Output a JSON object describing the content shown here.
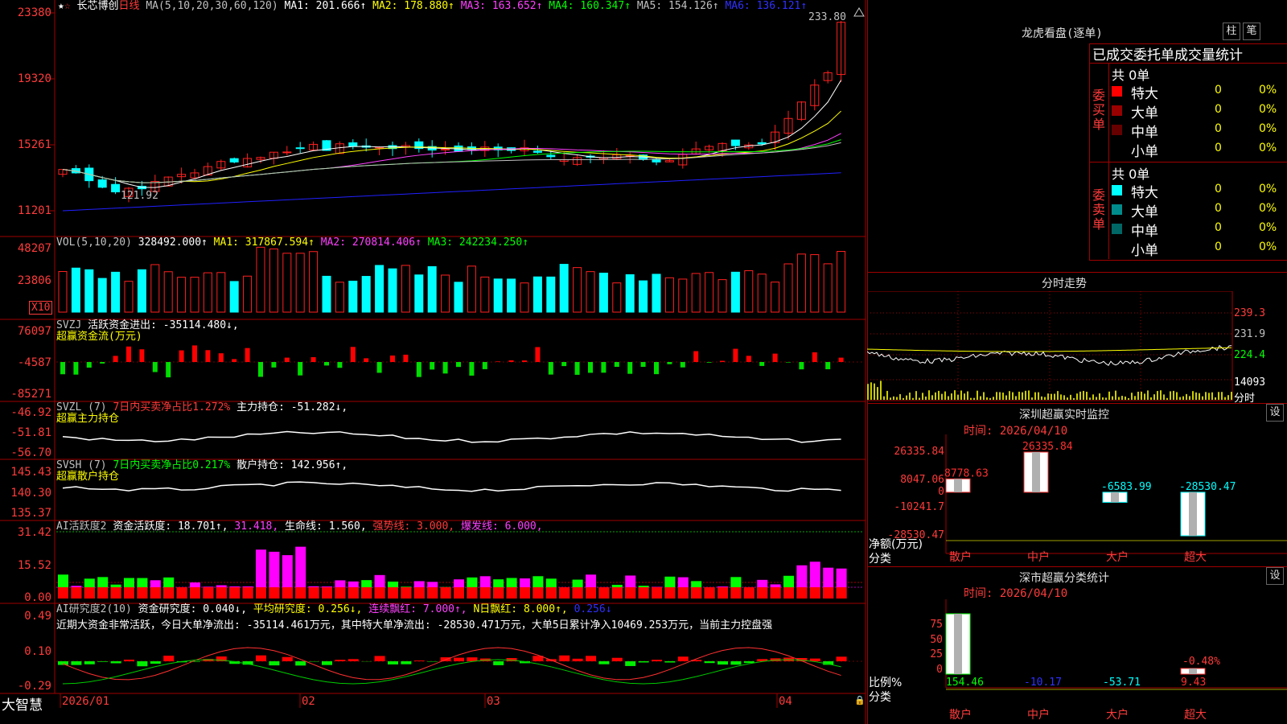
{
  "logo": "大智慧",
  "colors": {
    "up": "#ff2020",
    "down": "#00ffff",
    "ma1": "#ffffff",
    "ma2": "#ffff00",
    "ma3": "#ff40ff",
    "ma4": "#00ff00",
    "ma5": "#c0c0c0",
    "ma6": "#2020ff",
    "grid": "#a00000"
  },
  "main": {
    "stock_name": "长芯博创",
    "period": "日线",
    "ma_def": "MA(5,10,20,30,60,120)",
    "ma1": "MA1: 201.666↑",
    "ma2": "MA2: 178.880↑",
    "ma3": "MA3: 163.652↑",
    "ma4": "MA4: 160.347↑",
    "ma5": "MA5: 154.126↑",
    "ma6": "MA6: 136.121↑",
    "y_ticks": [
      "23380",
      "19320",
      "15261",
      "11201"
    ],
    "high_label": "233.80",
    "low_label": "121.92"
  },
  "vol": {
    "def": "VOL(5,10,20)",
    "value": "328492.000↑",
    "ma1": "MA1: 317867.594↑",
    "ma2": "MA2: 270814.406↑",
    "ma3": "MA3: 242234.250↑",
    "y_ticks": [
      "48207",
      "23806"
    ],
    "unit": "X10"
  },
  "svzj": {
    "def": "SVZJ",
    "label": "活跃资金进出: -35114.480↓,",
    "title2": "超赢资金流(万元)",
    "y_ticks": [
      "76097",
      "-4587",
      "-85271"
    ]
  },
  "svzl": {
    "def": "SVZL (7)",
    "ratio": "7日内买卖净占比1.272%",
    "label": "主力持仓: -51.282↓,",
    "title2": "超赢主力持仓",
    "y_ticks": [
      "-46.92",
      "-51.81",
      "-56.70"
    ]
  },
  "svsh": {
    "def": "SVSH (7)",
    "ratio": "7日内买卖净占比0.217%",
    "label": "散户持仓: 142.956↑,",
    "title2": "超赢散户持仓",
    "y_ticks": [
      "145.43",
      "140.30",
      "135.37"
    ]
  },
  "ai1": {
    "def": "AI活跃度2",
    "a": "资金活跃度: 18.701↑,",
    "b": "31.418,",
    "c": "生命线: 1.560,",
    "d": "强势线: 3.000,",
    "e": "爆发线: 6.000,",
    "y_ticks": [
      "31.42",
      "15.52",
      "0.00"
    ]
  },
  "ai2": {
    "def": "AI研究度2(10)",
    "a": "资金研究度: 0.040↓,",
    "b": "平均研究度: 0.256↓,",
    "c": "连续飘红: 7.000↑,",
    "d": "N日飘红: 8.000↑,",
    "e": "0.256↓",
    "comment": "近期大资金非常活跃，今日大单净流出: -35114.461万元，其中特大单净流出: -28530.471万元，大单5日累计净入10469.253万元，当前主力控盘强",
    "y_ticks": [
      "0.49",
      "0.10",
      "-0.29"
    ]
  },
  "x_axis": [
    "2026/01",
    "02",
    "03",
    "04"
  ],
  "lhb": {
    "title": "龙虎看盘(逐单)",
    "btn1": "柱",
    "btn2": "笔",
    "tabs": "已成交委托单成交量统计",
    "buy_side": "委买单",
    "sell_side": "委卖单",
    "buy_total": "共 0单",
    "sell_total": "共 0单",
    "buy_rows": [
      {
        "name": "特大",
        "count": "0",
        "pct": "0%",
        "color": "#ff0000"
      },
      {
        "name": "大单",
        "count": "0",
        "pct": "0%",
        "color": "#990000"
      },
      {
        "name": "中单",
        "count": "0",
        "pct": "0%",
        "color": "#660000"
      },
      {
        "name": "小单",
        "count": "0",
        "pct": "0%",
        "color": "#000000"
      }
    ],
    "sell_rows": [
      {
        "name": "特大",
        "count": "0",
        "pct": "0%",
        "color": "#00ffff"
      },
      {
        "name": "大单",
        "count": "0",
        "pct": "0%",
        "color": "#008c8c"
      },
      {
        "name": "中单",
        "count": "0",
        "pct": "0%",
        "color": "#006666"
      },
      {
        "name": "小单",
        "count": "0",
        "pct": "0%",
        "color": "#000000"
      }
    ]
  },
  "intraday": {
    "title": "分时走势",
    "y_ticks": [
      "239.3",
      "231.9",
      "224.4"
    ],
    "vol_tick": "14093",
    "unit_label": "分时"
  },
  "sz_monitor": {
    "title": "深圳超赢实时监控",
    "set": "设",
    "time": "时间: 2026/04/10",
    "y_ticks": [
      "26335.84",
      "8047.06",
      "0",
      "-10241.7",
      "-28530.47"
    ],
    "y_label": "净额(万元)",
    "x_label": "分类",
    "categories": [
      "散户",
      "中户",
      "大户",
      "超大"
    ],
    "values": [
      8778.63,
      26335.84,
      -6583.99,
      -28530.47
    ],
    "value_labels": [
      "8778.63",
      "26335.84",
      "-6583.99",
      "-28530.47"
    ]
  },
  "sz_class": {
    "title": "深市超赢分类统计",
    "set": "设",
    "time": "时间: 2026/04/10",
    "y_ticks": [
      "75",
      "50",
      "25",
      "0"
    ],
    "y_label": "比例%",
    "x_label": "分类",
    "categories": [
      "散户",
      "中户",
      "大户",
      "超大"
    ],
    "values": [
      154.46,
      -10.17,
      -53.71,
      9.43
    ],
    "value_labels": [
      "154.46",
      "-10.17",
      "-53.71",
      "9.43"
    ],
    "extra_label": "-0.48%"
  }
}
